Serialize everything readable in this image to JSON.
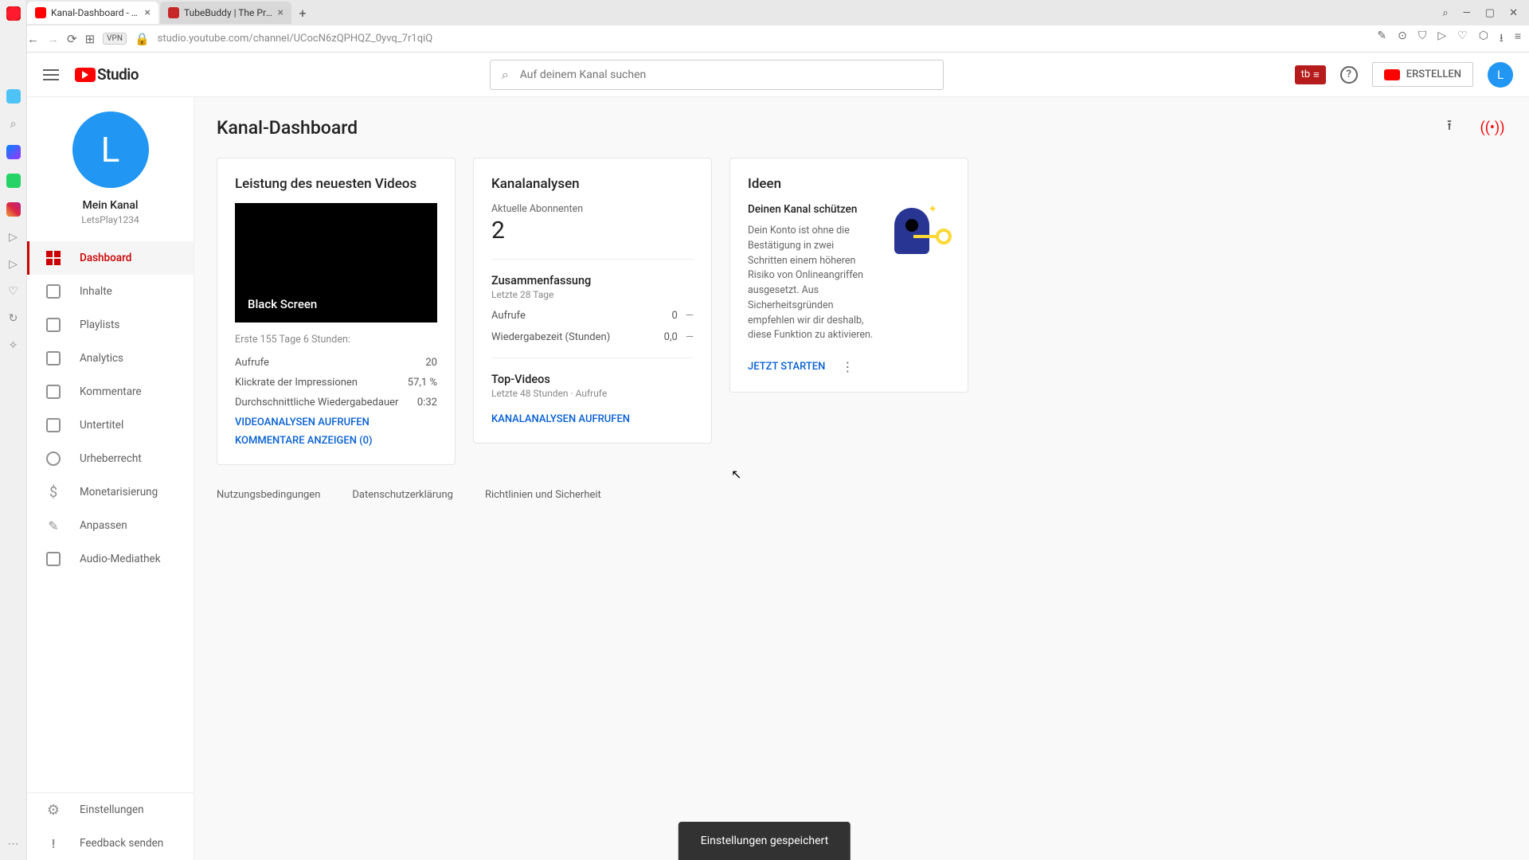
{
  "browser": {
    "tabs": [
      {
        "title": "Kanal-Dashboard - YouTu",
        "active": true
      },
      {
        "title": "TubeBuddy | The Premier",
        "active": false
      }
    ],
    "url": "studio.youtube.com/channel/UCocN6zQPHQZ_0yvq_7r1qiQ",
    "vpn": "VPN"
  },
  "header": {
    "logo": "Studio",
    "search_placeholder": "Auf deinem Kanal suchen",
    "tb_badge": "tb",
    "create_label": "ERSTELLEN",
    "avatar_letter": "L"
  },
  "sidebar": {
    "avatar_letter": "L",
    "channel_name": "Mein Kanal",
    "channel_handle": "LetsPlay1234",
    "items": [
      {
        "label": "Dashboard",
        "active": true
      },
      {
        "label": "Inhalte"
      },
      {
        "label": "Playlists"
      },
      {
        "label": "Analytics"
      },
      {
        "label": "Kommentare"
      },
      {
        "label": "Untertitel"
      },
      {
        "label": "Urheberrecht"
      },
      {
        "label": "Monetarisierung"
      },
      {
        "label": "Anpassen"
      },
      {
        "label": "Audio-Mediathek"
      }
    ],
    "bottom": [
      {
        "label": "Einstellungen"
      },
      {
        "label": "Feedback senden"
      }
    ]
  },
  "page": {
    "title": "Kanal-Dashboard"
  },
  "latest": {
    "card_title": "Leistung des neuesten Videos",
    "video_title": "Black Screen",
    "meta": "Erste 155 Tage 6 Stunden:",
    "rows": [
      {
        "label": "Aufrufe",
        "value": "20"
      },
      {
        "label": "Klickrate der Impressionen",
        "value": "57,1 %"
      },
      {
        "label": "Durchschnittliche Wiedergabedauer",
        "value": "0:32"
      }
    ],
    "link_video": "VIDEOANALYSEN AUFRUFEN",
    "link_comments": "KOMMENTARE ANZEIGEN (0)"
  },
  "analytics": {
    "card_title": "Kanalanalysen",
    "sub_label": "Aktuelle Abonnenten",
    "sub_count": "2",
    "summary_title": "Zusammenfassung",
    "summary_sub": "Letzte 28 Tage",
    "metrics": [
      {
        "label": "Aufrufe",
        "value": "0",
        "delta": "—"
      },
      {
        "label": "Wiedergabezeit (Stunden)",
        "value": "0,0",
        "delta": "—"
      }
    ],
    "top_title": "Top-Videos",
    "top_sub": "Letzte 48 Stunden · Aufrufe",
    "link": "KANALANALYSEN AUFRUFEN"
  },
  "ideas": {
    "card_title": "Ideen",
    "heading": "Deinen Kanal schützen",
    "body": "Dein Konto ist ohne die Bestätigung in zwei Schritten einem höheren Risiko von Onlineangriffen ausgesetzt. Aus Sicherheitsgründen empfehlen wir dir deshalb, diese Funktion zu aktivieren.",
    "cta": "JETZT STARTEN"
  },
  "footer": {
    "links": [
      "Nutzungsbedingungen",
      "Datenschutzerklärung",
      "Richtlinien und Sicherheit"
    ]
  },
  "toast": "Einstellungen gespeichert"
}
